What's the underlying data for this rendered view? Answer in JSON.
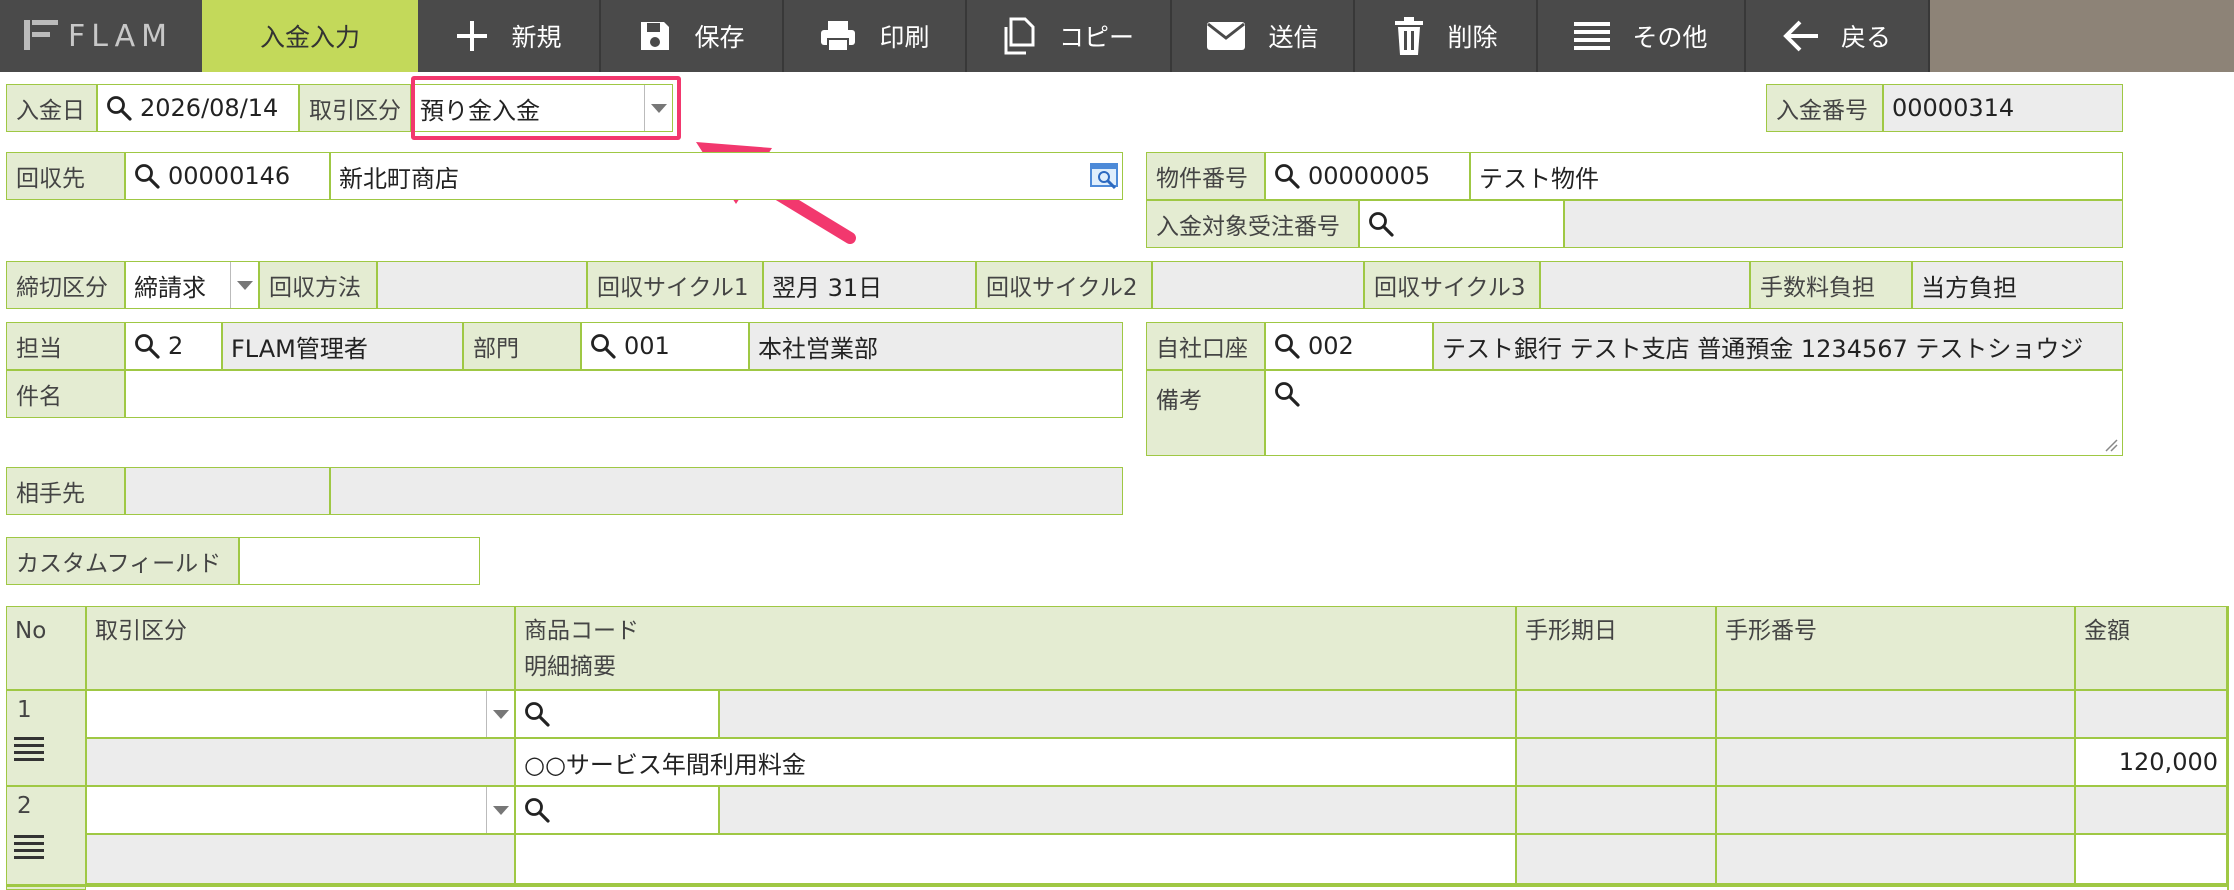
{
  "toolbar": {
    "logo": "FLAM",
    "active_tab": "入金入力",
    "buttons": [
      "新規",
      "保存",
      "印刷",
      "コピー",
      "送信",
      "削除",
      "その他",
      "戻る"
    ]
  },
  "header": {
    "deposit_date_label": "入金日",
    "deposit_date": "2026/08/14",
    "trade_type_label": "取引区分",
    "trade_type": "預り金入金",
    "deposit_no_label": "入金番号",
    "deposit_no": "00000314"
  },
  "collection": {
    "label": "回収先",
    "code": "00000146",
    "name": "新北町商店"
  },
  "property": {
    "no_label": "物件番号",
    "no": "00000005",
    "name": "テスト物件",
    "order_label": "入金対象受注番号",
    "order_no": ""
  },
  "billing": {
    "closing_label": "締切区分",
    "closing": "締請求",
    "method_label": "回収方法",
    "method": "",
    "cycle1_label": "回収サイクル1",
    "cycle1": "翌月 31日",
    "cycle2_label": "回収サイクル2",
    "cycle2": "",
    "cycle3_label": "回収サイクル3",
    "cycle3": "",
    "fee_label": "手数料負担",
    "fee": "当方負担"
  },
  "staff": {
    "label": "担当",
    "code": "2",
    "name": "FLAM管理者",
    "dept_label": "部門",
    "dept_code": "001",
    "dept_name": "本社営業部"
  },
  "account": {
    "label": "自社口座",
    "code": "002",
    "name": "テスト銀行 テスト支店 普通預金 1234567 テストショウジ"
  },
  "subject": {
    "label": "件名",
    "value": ""
  },
  "remarks": {
    "label": "備考",
    "value": ""
  },
  "partner": {
    "label": "相手先",
    "code": "",
    "name": ""
  },
  "custom": {
    "label": "カスタムフィールド",
    "value": ""
  },
  "table": {
    "headers": {
      "no": "No",
      "trade_type": "取引区分",
      "product_code": "商品コード",
      "summary": "明細摘要",
      "bill_due": "手形期日",
      "bill_no": "手形番号",
      "amount": "金額"
    },
    "rows": [
      {
        "no": "1",
        "summary": "○○サービス年間利用料金",
        "amount": "120,000"
      },
      {
        "no": "2",
        "summary": "",
        "amount": ""
      }
    ]
  },
  "colors": {
    "accent": "#c3d95a",
    "border": "#9fc844",
    "label_bg": "#e4ecd2",
    "highlight": "#f2386e"
  }
}
